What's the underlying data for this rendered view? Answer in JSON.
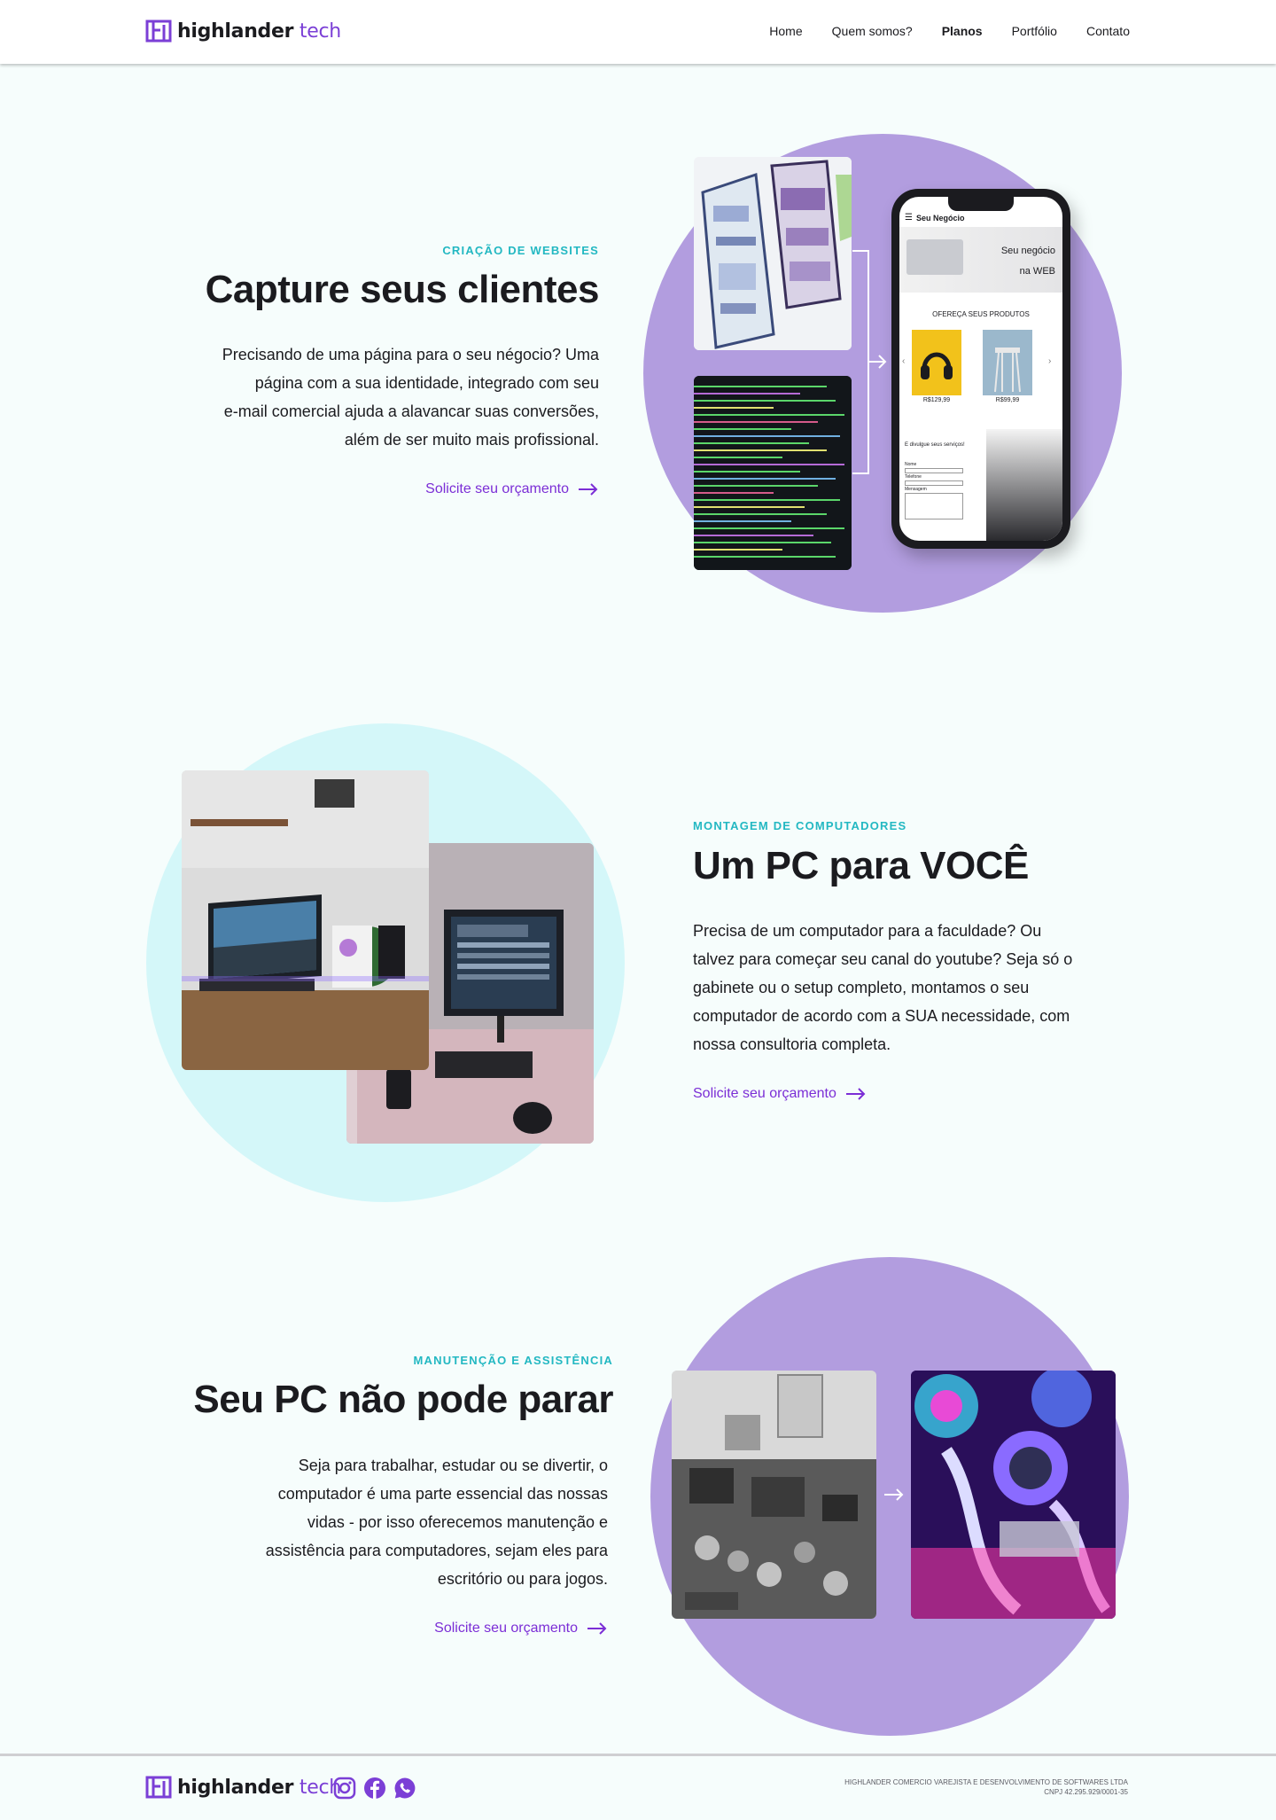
{
  "brand": {
    "name_bold": "highlander",
    "name_light": "tech",
    "accent": "#7b3fd6",
    "teal": "#23b8c2"
  },
  "nav": {
    "items": [
      "Home",
      "Quem somos?",
      "Planos",
      "Portfólio",
      "Contato"
    ]
  },
  "section1": {
    "kicker": "CRIAÇÃO DE WEBSITES",
    "title": "Capture seus clientes",
    "lines": [
      "Precisando de uma página para o seu négocio? Uma",
      "página com a sua identidade, integrado com seu",
      "e-mail comercial ajuda a alavancar suas conversões,",
      "além de ser muito mais profissional."
    ],
    "cta": "Solicite seu orçamento",
    "phone": {
      "brand": "Seu Negócio",
      "hero_line1": "Seu negócio",
      "hero_line2": "na WEB",
      "products_heading": "OFEREÇA SEUS PRODUTOS",
      "price1": "R$129,99",
      "price2": "R$99,99",
      "promo": "E divulgue seus serviços!",
      "field1": "Nome",
      "field2": "Telefone",
      "field3": "Mensagem"
    }
  },
  "section2": {
    "kicker": "MONTAGEM DE COMPUTADORES",
    "title": "Um PC para VOCÊ",
    "lines": [
      "Precisa de um computador para a faculdade? Ou",
      "talvez para começar seu canal do youtube? Seja só o",
      "gabinete ou o setup completo, montamos o seu",
      "computador de acordo com a SUA necessidade, com",
      "nossa consultoria completa."
    ],
    "cta": "Solicite seu orçamento"
  },
  "section3": {
    "kicker": "MANUTENÇÃO E ASSISTÊNCIA",
    "title": "Seu PC não pode parar",
    "lines": [
      "Seja para trabalhar, estudar ou se divertir, o",
      "computador é uma parte essencial das nossas",
      "vidas - por isso oferecemos manutenção e",
      "assistência para computadores, sejam eles para",
      "escritório ou para jogos."
    ],
    "cta": "Solicite seu orçamento"
  },
  "footer": {
    "social_icons": [
      "instagram-icon",
      "facebook-icon",
      "whatsapp-icon"
    ],
    "legal_line1": "HIGHLANDER COMERCIO VAREJISTA E DESENVOLVIMENTO DE SOFTWARES LTDA",
    "legal_line2": "CNPJ 42.295.929/0001-35"
  }
}
